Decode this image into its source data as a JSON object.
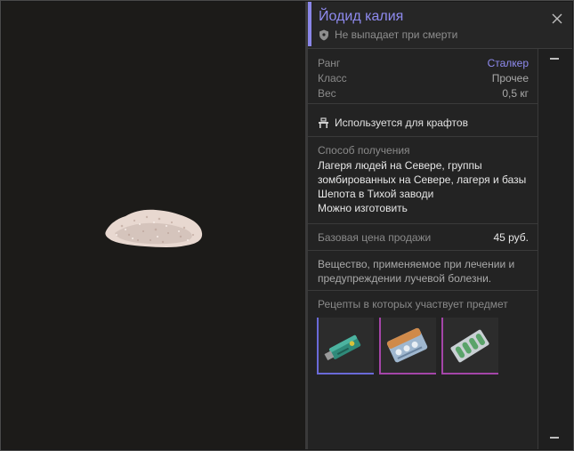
{
  "item": {
    "title": "Йодид калия",
    "drop_status": "Не выпадает при смерти",
    "stats": [
      {
        "label": "Ранг",
        "value": "Сталкер",
        "accent": true
      },
      {
        "label": "Класс",
        "value": "Прочее",
        "accent": false
      },
      {
        "label": "Вес",
        "value": "0,5 кг",
        "accent": false
      }
    ],
    "craft_note": "Используется для крафтов",
    "source": {
      "label": "Способ получения",
      "lines": [
        "Лагеря людей на Севере, группы",
        "зомбированных на Севере, лагеря и базы",
        "Шепота в Тихой заводи",
        "Можно изготовить"
      ]
    },
    "price": {
      "label": "Базовая цена продажи",
      "value": "45 руб."
    },
    "description": "Вещество, применяемое при лечении и предупреждении лучевой болезни.",
    "recipes_label": "Рецепты в которых участвует предмет",
    "recipes": [
      {
        "icon": "usb-device-icon",
        "color": "#6a6ad8"
      },
      {
        "icon": "blister-pack-icon",
        "color": "#a445a8"
      },
      {
        "icon": "pill-strip-icon",
        "color": "#a445a8"
      }
    ]
  },
  "colors": {
    "accent": "#8f8bf0",
    "panel": "#232323",
    "preview_bg": "#1c1b19"
  }
}
